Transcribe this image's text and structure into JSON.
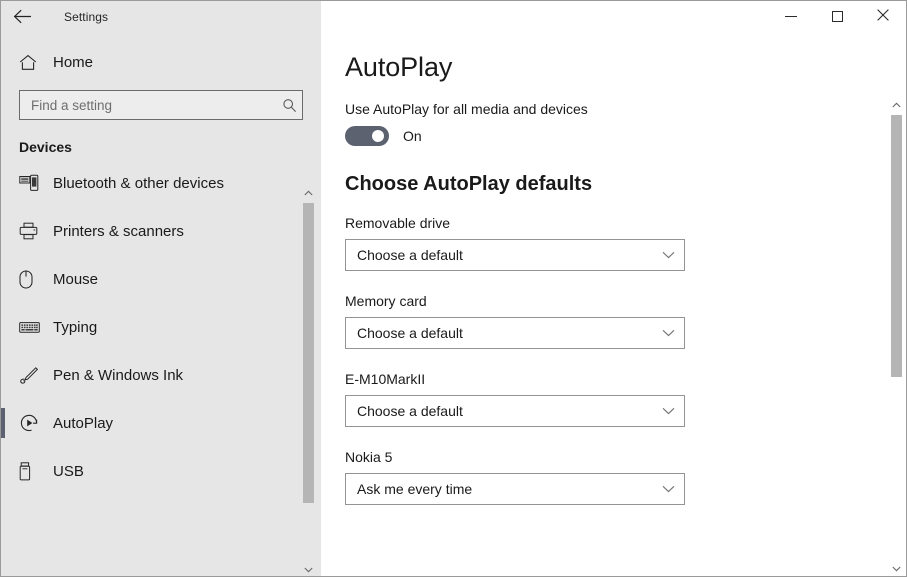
{
  "titlebar": {
    "back_icon": "back-arrow-icon",
    "title": "Settings",
    "minimize_icon": "minimize-icon",
    "maximize_icon": "maximize-icon",
    "close_icon": "close-icon"
  },
  "sidebar": {
    "home": {
      "label": "Home",
      "icon": "home-icon"
    },
    "search": {
      "value": "",
      "placeholder": "Find a setting",
      "icon": "search-icon"
    },
    "section_header": "Devices",
    "items": [
      {
        "label": "Bluetooth & other devices",
        "icon": "bluetooth-devices-icon",
        "selected": false
      },
      {
        "label": "Printers & scanners",
        "icon": "printer-icon",
        "selected": false
      },
      {
        "label": "Mouse",
        "icon": "mouse-icon",
        "selected": false
      },
      {
        "label": "Typing",
        "icon": "keyboard-icon",
        "selected": false
      },
      {
        "label": "Pen & Windows Ink",
        "icon": "pen-icon",
        "selected": false
      },
      {
        "label": "AutoPlay",
        "icon": "autoplay-icon",
        "selected": true
      },
      {
        "label": "USB",
        "icon": "usb-icon",
        "selected": false
      }
    ],
    "scrollbar": {
      "up_icon": "chevron-up-icon",
      "down_icon": "chevron-down-icon"
    }
  },
  "main": {
    "page_title": "AutoPlay",
    "toggle": {
      "caption": "Use AutoPlay for all media and devices",
      "state": "On",
      "on": true
    },
    "defaults_title": "Choose AutoPlay defaults",
    "fields": [
      {
        "label": "Removable drive",
        "value": "Choose a default",
        "chevron": "chevron-down-icon"
      },
      {
        "label": "Memory card",
        "value": "Choose a default",
        "chevron": "chevron-down-icon"
      },
      {
        "label": "E-M10MarkII",
        "value": "Choose a default",
        "chevron": "chevron-down-icon"
      },
      {
        "label": "Nokia 5",
        "value": "Ask me every time",
        "chevron": "chevron-down-icon"
      }
    ],
    "scrollbar": {
      "up_icon": "chevron-up-icon",
      "down_icon": "chevron-down-icon"
    }
  },
  "colors": {
    "sidebar_bg": "#e6e6e6",
    "accent_toggle": "#5c6270",
    "selection_bar": "#5c6270",
    "text": "#1a1a1a",
    "scroll_thumb": "#b5b5b5"
  }
}
